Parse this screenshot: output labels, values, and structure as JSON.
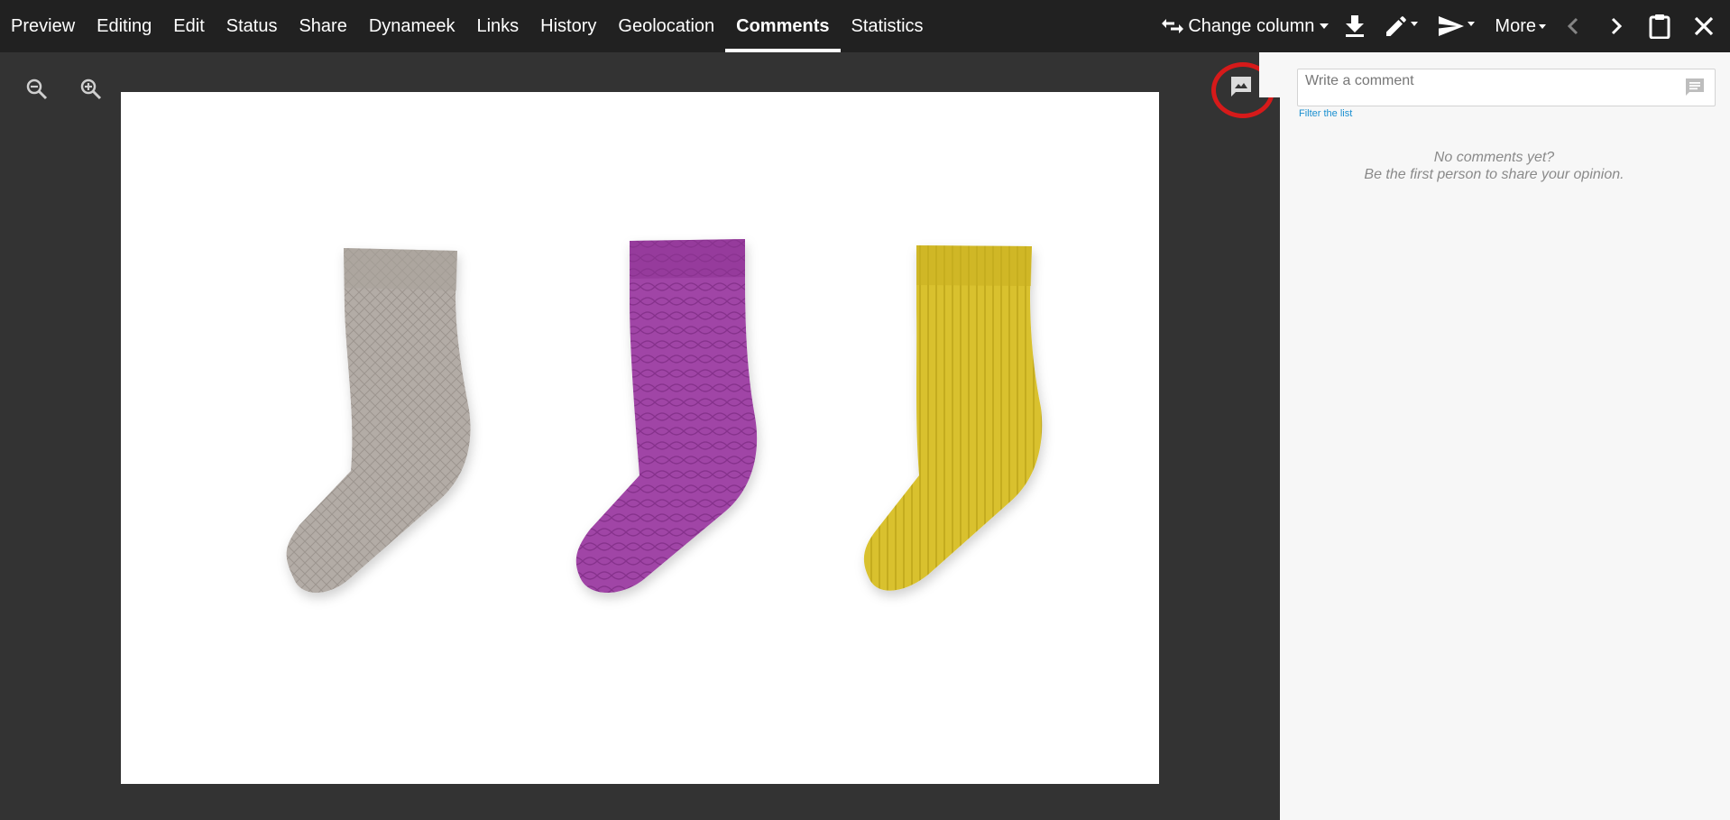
{
  "nav": {
    "tabs": [
      {
        "label": "Preview"
      },
      {
        "label": "Editing"
      },
      {
        "label": "Edit"
      },
      {
        "label": "Status"
      },
      {
        "label": "Share"
      },
      {
        "label": "Dynameek"
      },
      {
        "label": "Links"
      },
      {
        "label": "History"
      },
      {
        "label": "Geolocation"
      },
      {
        "label": "Comments",
        "active": true
      },
      {
        "label": "Statistics"
      }
    ],
    "change_column_label": "Change column",
    "more_label": "More"
  },
  "icons": {
    "swap": "swap-horizontal-icon",
    "download": "download-icon",
    "edit": "pencil-icon",
    "send": "send-icon",
    "prev": "chevron-left-icon",
    "next": "chevron-right-icon",
    "clipboard": "clipboard-icon",
    "close": "close-icon",
    "zoom_out": "zoom-out-icon",
    "zoom_in": "zoom-in-icon",
    "comment_toggle": "image-comment-icon",
    "comment": "comment-icon"
  },
  "viewer": {
    "image_subject": "Three knitted socks: grey, purple and yellow"
  },
  "comments": {
    "placeholder": "Write a comment",
    "filter_label": "Filter the list",
    "empty_line1": "No comments yet?",
    "empty_line2": "Be the first person to share your opinion."
  },
  "colors": {
    "topbar": "#212121",
    "background": "#333333",
    "panel": "#f7f7f7",
    "highlight": "#d61a1a",
    "link": "#1a8fd0",
    "sock_grey": "#b3aca6",
    "sock_purple": "#a044a6",
    "sock_yellow": "#d9c12e"
  }
}
